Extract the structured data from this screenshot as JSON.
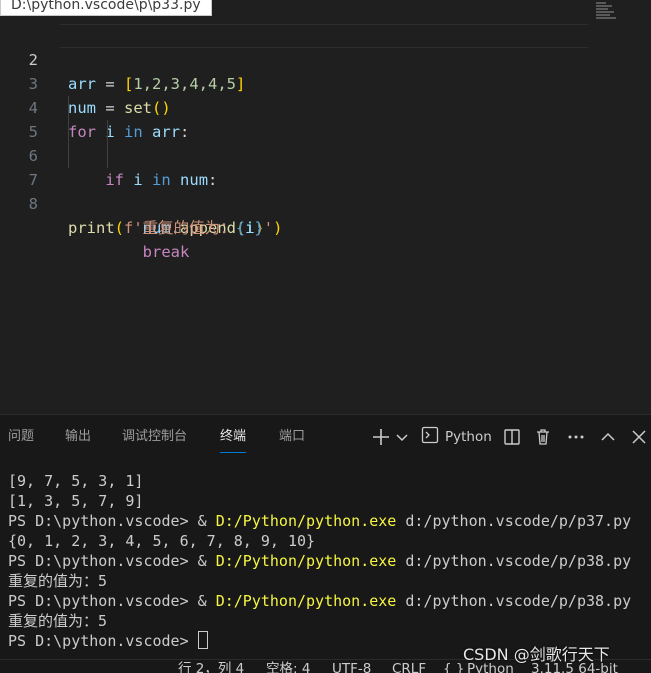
{
  "editor": {
    "file_path": "D:\\python.vscode\\p\\p33.py",
    "lines": [
      {
        "number": "2"
      },
      {
        "number": "3"
      },
      {
        "number": "4"
      },
      {
        "number": "5"
      },
      {
        "number": "6"
      },
      {
        "number": "7"
      },
      {
        "number": "8"
      }
    ],
    "code": {
      "l2_var": "arr",
      "l2_eq": " = ",
      "l2_open": "[",
      "l2_vals": "1,2,3,4,4,5",
      "l2_close": "]",
      "l3_var": "num",
      "l3_eq": " = ",
      "l3_fn": "set",
      "l3_parens": "()",
      "l4_for": "for",
      "l4_i": "i",
      "l4_in": "in",
      "l4_arr": "arr",
      "l4_colon": ":",
      "l5_if": "if",
      "l5_i": "i",
      "l5_in": "in",
      "l5_num": "num",
      "l5_colon": ":",
      "l6_num": "num",
      "l6_dot": ".",
      "l6_fn": "append",
      "l6_open": "(",
      "l6_i": "i",
      "l6_close": ")",
      "l7_break": "break",
      "l8_fn": "print",
      "l8_open": "(",
      "l8_str1": "f'重复的值为：",
      "l8_brace_open": "{",
      "l8_i": "i",
      "l8_brace_close": "}",
      "l8_str2": "'",
      "l8_close": ")"
    }
  },
  "panel": {
    "tabs": [
      "问题",
      "输出",
      "调试控制台",
      "终端",
      "端口"
    ],
    "active_tab": "终端",
    "terminal_profile": "Python",
    "icons": [
      "plus-icon",
      "chevron-down-icon",
      "terminal-icon",
      "split-icon",
      "trash-icon",
      "more-icon",
      "chevron-up-icon",
      "close-icon"
    ]
  },
  "terminal": {
    "out1": "[9, 7, 5, 3, 1]",
    "out2": "[1, 3, 5, 7, 9]",
    "prompt": "PS D:\\python.vscode> ",
    "amp": "& ",
    "exe": "D:/Python/python.exe",
    "script_p37": " d:/python.vscode/p/p37.py",
    "out3": "{0, 1, 2, 3, 4, 5, 6, 7, 8, 9, 10}",
    "script_p38": " d:/python.vscode/p/p38.py",
    "out4": "重复的值为：5",
    "out5": "重复的值为：5"
  },
  "statusbar": {
    "position": "行 2，列 4",
    "indent": "空格: 4",
    "encoding": "UTF-8",
    "eol": "CRLF",
    "language_icon": "{ }",
    "language": "Python",
    "interpreter": "3.11.5 64-bit"
  },
  "watermark": "CSDN @剑歌行天下",
  "colors": {
    "editor_bg": "#1f1f1f",
    "panel_bg": "#181818",
    "accent": "#0078d4",
    "keyword": "#c586c0",
    "builtin_keyword": "#569cd6",
    "variable": "#9cdcfe",
    "function": "#dcdcaa",
    "number": "#b5cea8",
    "string": "#ce9178",
    "exe_path": "#f5f543"
  }
}
